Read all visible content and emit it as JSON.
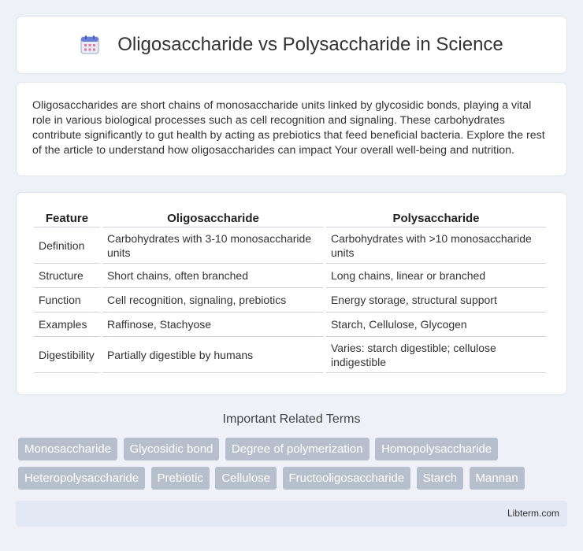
{
  "header": {
    "title": "Oligosaccharide vs Polysaccharide in Science",
    "icon": "calendar-icon"
  },
  "intro": {
    "text": "Oligosaccharides are short chains of monosaccharide units linked by glycosidic bonds, playing a vital role in various biological processes such as cell recognition and signaling. These carbohydrates contribute significantly to gut health by acting as prebiotics that feed beneficial bacteria. Explore the rest of the article to understand how oligosaccharides can impact Your overall well-being and nutrition."
  },
  "table": {
    "headers": [
      "Feature",
      "Oligosaccharide",
      "Polysaccharide"
    ],
    "rows": [
      [
        "Definition",
        "Carbohydrates with 3-10 monosaccharide units",
        "Carbohydrates with >10 monosaccharide units"
      ],
      [
        "Structure",
        "Short chains, often branched",
        "Long chains, linear or branched"
      ],
      [
        "Function",
        "Cell recognition, signaling, prebiotics",
        "Energy storage, structural support"
      ],
      [
        "Examples",
        "Raffinose, Stachyose",
        "Starch, Cellulose, Glycogen"
      ],
      [
        "Digestibility",
        "Partially digestible by humans",
        "Varies: starch digestible; cellulose indigestible"
      ]
    ]
  },
  "terms": {
    "title": "Important Related Terms",
    "items": [
      "Monosaccharide",
      "Glycosidic bond",
      "Degree of polymerization",
      "Homopolysaccharide",
      "Heteropolysaccharide",
      "Prebiotic",
      "Cellulose",
      "Fructooligosaccharide",
      "Starch",
      "Mannan"
    ]
  },
  "footer": {
    "text": "Libterm.com"
  }
}
